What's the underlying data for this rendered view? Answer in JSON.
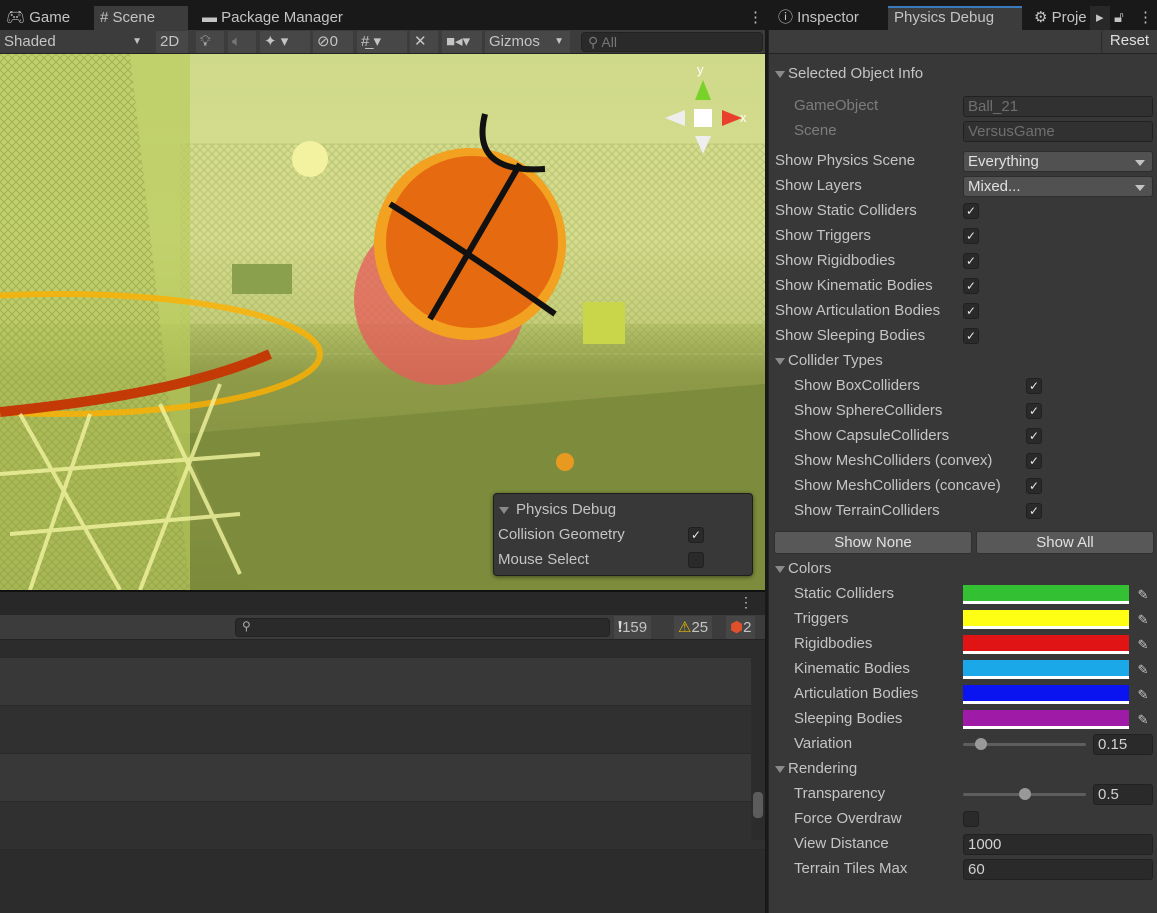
{
  "scene_window": {
    "tabs": [
      {
        "label": "Game",
        "icon": "gamepad-icon"
      },
      {
        "label": "Scene",
        "icon": "hash-icon"
      },
      {
        "label": "Package Manager",
        "icon": "package-icon"
      }
    ],
    "toolbar": {
      "shading_mode": "Shaded",
      "mode_2d": "2D",
      "hidden_count": "0",
      "gizmos_label": "Gizmos",
      "search_placeholder": "All"
    },
    "overlay": {
      "title": "Physics Debug",
      "collision_geometry_label": "Collision Geometry",
      "collision_geometry_checked": true,
      "mouse_select_label": "Mouse Select",
      "mouse_select_checked": false
    },
    "gizmo_axes": {
      "y": "y",
      "x": "x"
    }
  },
  "console": {
    "log_count": "159",
    "warning_count": "25",
    "error_count": "2"
  },
  "inspector": {
    "tabs": [
      {
        "label": "Inspector",
        "icon": "info-icon"
      },
      {
        "label": "Physics Debug"
      },
      {
        "label": "Proje",
        "icon": "gear-icon"
      }
    ],
    "reset_label": "Reset",
    "selected_object_info": {
      "title": "Selected Object Info",
      "gameobject_label": "GameObject",
      "gameobject_value": "Ball_21",
      "scene_label": "Scene",
      "scene_value": "VersusGame"
    },
    "show_physics_scene": {
      "label": "Show Physics Scene",
      "value": "Everything"
    },
    "show_layers": {
      "label": "Show Layers",
      "value": "Mixed..."
    },
    "toggles": [
      {
        "label": "Show Static Colliders",
        "checked": true
      },
      {
        "label": "Show Triggers",
        "checked": true
      },
      {
        "label": "Show Rigidbodies",
        "checked": true
      },
      {
        "label": "Show Kinematic Bodies",
        "checked": true
      },
      {
        "label": "Show Articulation Bodies",
        "checked": true
      },
      {
        "label": "Show Sleeping Bodies",
        "checked": true
      }
    ],
    "collider_types": {
      "title": "Collider Types",
      "items": [
        {
          "label": "Show BoxColliders",
          "checked": true
        },
        {
          "label": "Show SphereColliders",
          "checked": true
        },
        {
          "label": "Show CapsuleColliders",
          "checked": true
        },
        {
          "label": "Show MeshColliders (convex)",
          "checked": true
        },
        {
          "label": "Show MeshColliders (concave)",
          "checked": true
        },
        {
          "label": "Show TerrainColliders",
          "checked": true
        }
      ]
    },
    "show_none_label": "Show None",
    "show_all_label": "Show All",
    "colors": {
      "title": "Colors",
      "items": [
        {
          "label": "Static Colliders",
          "color": "#33c033"
        },
        {
          "label": "Triggers",
          "color": "#ffff14"
        },
        {
          "label": "Rigidbodies",
          "color": "#e01414"
        },
        {
          "label": "Kinematic Bodies",
          "color": "#1aa8e8"
        },
        {
          "label": "Articulation Bodies",
          "color": "#0a14f0"
        },
        {
          "label": "Sleeping Bodies",
          "color": "#a01aa8"
        }
      ],
      "variation_label": "Variation",
      "variation_value": "0.15"
    },
    "rendering": {
      "title": "Rendering",
      "transparency_label": "Transparency",
      "transparency_value": "0.5",
      "force_overdraw_label": "Force Overdraw",
      "force_overdraw_checked": false,
      "view_distance_label": "View Distance",
      "view_distance_value": "1000",
      "terrain_tiles_label": "Terrain Tiles Max",
      "terrain_tiles_value": "60"
    }
  }
}
